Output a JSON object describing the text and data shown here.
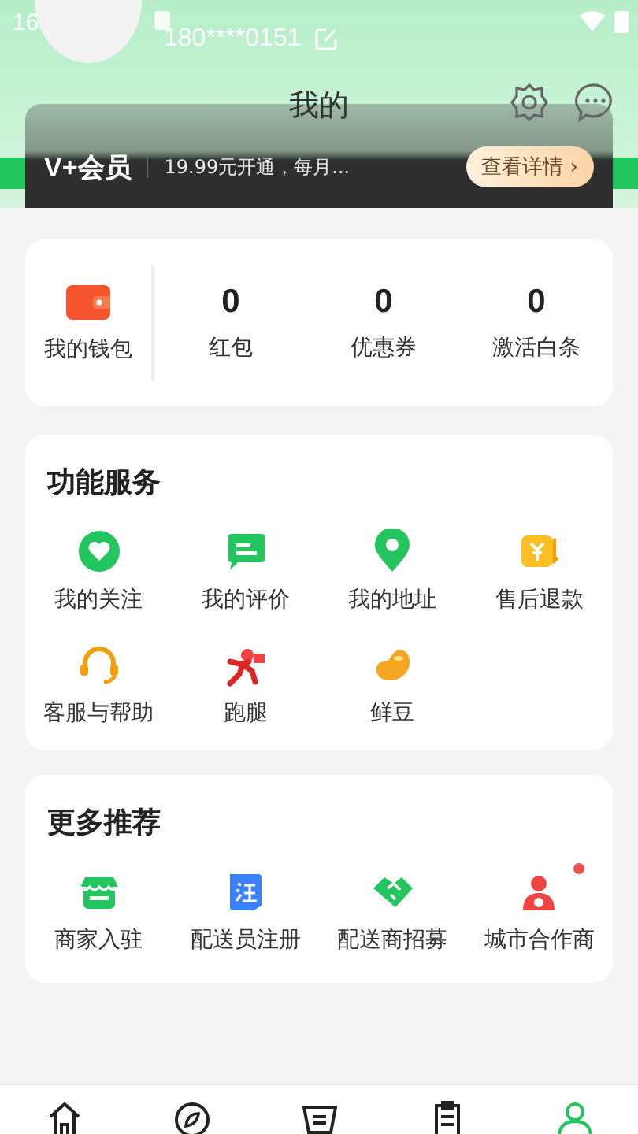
{
  "status_bar": {
    "time": "16"
  },
  "profile": {
    "phone": "180****0151"
  },
  "header": {
    "title": "我的"
  },
  "vip": {
    "brand": "V+会员",
    "offer": "19.99元开通，每月...",
    "button": "查看详情 ›"
  },
  "wallet": {
    "label": "我的钱包",
    "stats": [
      {
        "value": "0",
        "label": "红包"
      },
      {
        "value": "0",
        "label": "优惠券"
      },
      {
        "value": "0",
        "label": "激活白条"
      }
    ]
  },
  "services": {
    "title": "功能服务",
    "items": [
      {
        "kind": "heart",
        "label": "我的关注"
      },
      {
        "kind": "comment",
        "label": "我的评价"
      },
      {
        "kind": "pin",
        "label": "我的地址"
      },
      {
        "kind": "refund",
        "label": "售后退款"
      },
      {
        "kind": "headset",
        "label": "客服与帮助"
      },
      {
        "kind": "runner",
        "label": "跑腿"
      },
      {
        "kind": "bean",
        "label": "鲜豆"
      }
    ]
  },
  "recommend": {
    "title": "更多推荐",
    "items": [
      {
        "kind": "shop",
        "label": "商家入驻",
        "dot": false
      },
      {
        "kind": "register",
        "label": "配送员注册",
        "dot": false
      },
      {
        "kind": "handshake",
        "label": "配送商招募",
        "dot": false
      },
      {
        "kind": "partner",
        "label": "城市合作商",
        "dot": true
      }
    ]
  },
  "tab_bar": [
    {
      "kind": "home",
      "selected": false
    },
    {
      "kind": "compass",
      "selected": false
    },
    {
      "kind": "basket",
      "selected": false
    },
    {
      "kind": "orders",
      "selected": false
    },
    {
      "kind": "profile",
      "selected": true
    }
  ]
}
